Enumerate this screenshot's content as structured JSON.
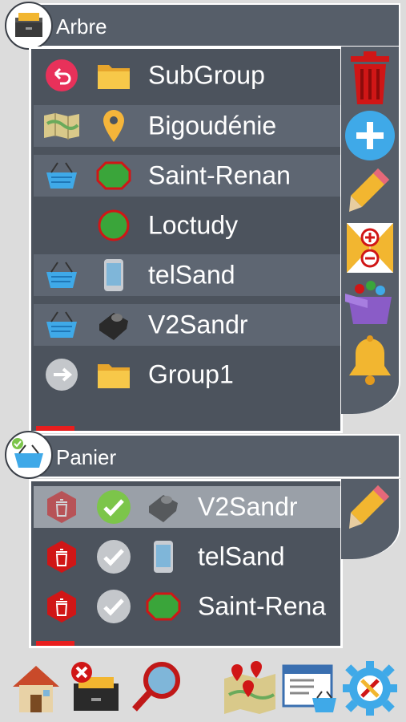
{
  "arbre": {
    "title": "Arbre",
    "rows": [
      {
        "label": "SubGroup",
        "left_icon": "back-arrow-icon",
        "type_icon": "folder-icon"
      },
      {
        "label": "Bigoudénie",
        "left_icon": "map-icon",
        "type_icon": "location-pin-icon"
      },
      {
        "label": "Saint-Renan",
        "left_icon": "basket-icon",
        "type_icon": "green-area-icon"
      },
      {
        "label": "Loctudy",
        "left_icon": "",
        "type_icon": "green-circle-icon"
      },
      {
        "label": "telSand",
        "left_icon": "basket-icon",
        "type_icon": "phone-icon"
      },
      {
        "label": "V2Sandr",
        "left_icon": "basket-icon",
        "type_icon": "tracker-device-icon"
      },
      {
        "label": "Group1",
        "left_icon": "forward-arrow-icon",
        "type_icon": "folder-icon"
      }
    ],
    "side_actions": [
      "trash-icon",
      "add-icon",
      "pencil-icon",
      "zoom-hourglass-icon",
      "toy-box-icon",
      "bell-icon"
    ]
  },
  "panier": {
    "title": "Panier",
    "rows": [
      {
        "label": "V2Sandr",
        "delete_icon": "delete-hexagon-icon",
        "check_icon": "check-green-icon",
        "type_icon": "tracker-device-icon",
        "selected": true
      },
      {
        "label": "telSand",
        "delete_icon": "delete-hexagon-icon",
        "check_icon": "check-grey-icon",
        "type_icon": "phone-icon",
        "selected": false
      },
      {
        "label": "Saint-Rena",
        "delete_icon": "delete-hexagon-icon",
        "check_icon": "check-grey-icon",
        "type_icon": "green-area-icon",
        "selected": false
      }
    ],
    "side_actions": [
      "pencil-icon"
    ]
  },
  "bottom_bar": [
    "home-icon",
    "close-cabinet-icon",
    "search-icon",
    "map-pins-icon",
    "basket-window-icon",
    "settings-gear-icon"
  ],
  "colors": {
    "panel": "#4c535d",
    "header": "#565e69",
    "accent_red": "#e81e1e",
    "accent_blue": "#3fa9e8",
    "check_green": "#7cc54a"
  }
}
